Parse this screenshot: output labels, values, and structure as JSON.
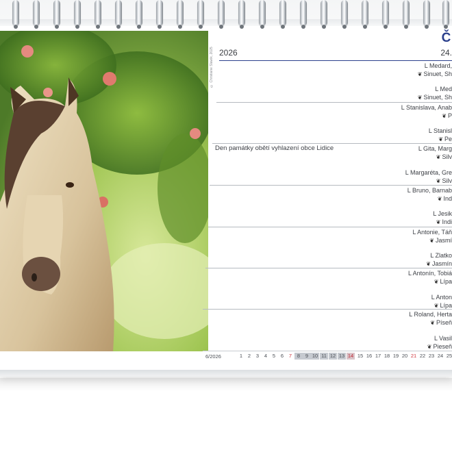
{
  "photo": {
    "credit": "© Christiane Slawik, 2025"
  },
  "calendar": {
    "month": "ČE",
    "year": "2026",
    "week": "24.",
    "holiday": "Den památky obětí vyhlazení obce Lidice",
    "days": [
      {
        "cz": "L Medard,",
        "sk": "Sinuet, Sh"
      },
      {
        "cz": "L Med",
        "sk": "Sinuet, Sh"
      },
      {
        "cz": "L Stanislava, Anab",
        "sk": "P"
      },
      {
        "cz": "L Stanisl",
        "sk": "Pe"
      },
      {
        "cz": "L Gita, Marg",
        "sk": "Silv"
      },
      {
        "cz": "L Margaréta, Gre",
        "sk": "Silv"
      },
      {
        "cz": "L Bruno, Barnab",
        "sk": "Ind"
      },
      {
        "cz": "L Jesik",
        "sk": "Indi"
      },
      {
        "cz": "L Antonie, Táň",
        "sk": "Jasmí"
      },
      {
        "cz": "L Zlatko",
        "sk": "Jasmín"
      },
      {
        "cz": "L Antonín, Tobiá",
        "sk": "Lípa"
      },
      {
        "cz": "L Anton",
        "sk": "Lípa"
      },
      {
        "cz": "L Roland, Herta",
        "sk": "Píseň"
      },
      {
        "cz": "L Vasil",
        "sk": "Pieseň"
      }
    ],
    "strip": {
      "label": "6/2026",
      "days": [
        "1",
        "2",
        "3",
        "4",
        "5",
        "6",
        "7",
        "8",
        "9",
        "10",
        "11",
        "12",
        "13",
        "14",
        "15",
        "16",
        "17",
        "18",
        "19",
        "20",
        "21",
        "22",
        "23",
        "24",
        "25"
      ]
    }
  },
  "icons": {
    "flower": "flower-icon"
  }
}
